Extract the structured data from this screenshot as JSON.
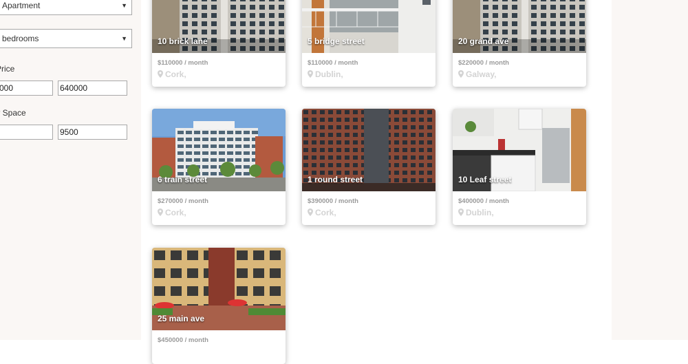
{
  "filters": {
    "property_type": "Apartment",
    "bedrooms": "bedrooms",
    "price_label": "Price",
    "price_min": "000",
    "price_max": "640000",
    "floor_label": "Floor Space",
    "floor_min": "",
    "floor_max": "9500"
  },
  "listings": [
    {
      "title": "10 brick lane",
      "price": "$110000 / month",
      "location": "Cork,",
      "photo": "tower-grey"
    },
    {
      "title": "5 bridge street",
      "price": "$110000 / month",
      "location": "Dublin,",
      "photo": "modern-balcony"
    },
    {
      "title": "20 grand ave",
      "price": "$220000 / month",
      "location": "Galway,",
      "photo": "tower-grey"
    },
    {
      "title": "6 train street",
      "price": "$270000 / month",
      "location": "Cork,",
      "photo": "riverside-block"
    },
    {
      "title": "1 round street",
      "price": "$390000 / month",
      "location": "Cork,",
      "photo": "brick-tower"
    },
    {
      "title": "10 Leaf street",
      "price": "$400000 / month",
      "location": "Dublin,",
      "photo": "kitchen"
    },
    {
      "title": "25 main ave",
      "price": "$450000 / month",
      "location": "",
      "photo": "courtyard"
    }
  ],
  "icons": {
    "location": "map-pin-icon",
    "dropdown": "caret-down-icon"
  }
}
